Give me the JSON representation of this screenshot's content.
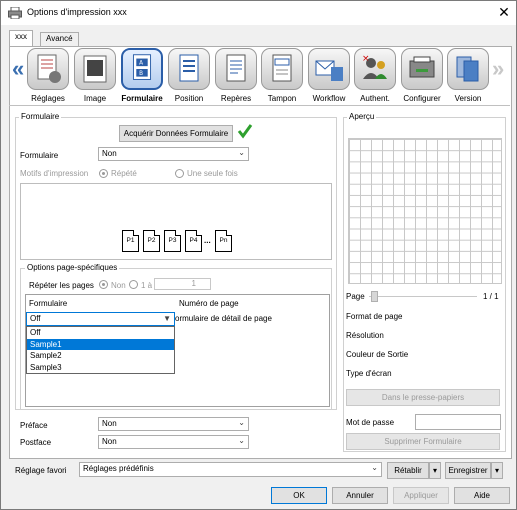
{
  "window": {
    "title": "Options d'impression xxx",
    "close": "✕"
  },
  "tabs": [
    "xxx",
    "Avancé"
  ],
  "nav": {
    "prev": "«",
    "next": "»"
  },
  "toolbar": [
    {
      "name": "reglages",
      "label": "Réglages"
    },
    {
      "name": "image",
      "label": "Image"
    },
    {
      "name": "formulaire",
      "label": "Formulaire"
    },
    {
      "name": "position",
      "label": "Position"
    },
    {
      "name": "reperes",
      "label": "Repères"
    },
    {
      "name": "tampon",
      "label": "Tampon"
    },
    {
      "name": "workflow",
      "label": "Workflow"
    },
    {
      "name": "authent",
      "label": "Authent."
    },
    {
      "name": "configurer",
      "label": "Configurer"
    },
    {
      "name": "version",
      "label": "Version"
    }
  ],
  "formulaire": {
    "group_label": "Formulaire",
    "acquire_button": "Acquérir Données Formulaire",
    "form_label": "Formulaire",
    "form_value": "Non",
    "motifs_label": "Motifs d'impression",
    "radio_repete": "Répété",
    "radio_seule": "Une seule fois",
    "pages": [
      "P1",
      "P2",
      "P3",
      "P4",
      "Pn"
    ],
    "ellipsis": "..."
  },
  "options": {
    "group_label": "Options page-spécifiques",
    "repeat_label": "Répéter les pages",
    "radio_non": "Non",
    "radio_1a": "1 à",
    "spin_value": "1",
    "col_formulaire": "Formulaire",
    "col_numero": "Numéro de page",
    "combo_value": "Off",
    "detail_text": "ormulaire de détail de page",
    "dropdown_items": [
      "Off",
      "Sample1",
      "Sample2",
      "Sample3"
    ],
    "dropdown_selected": "Sample1"
  },
  "preface": {
    "label": "Préface",
    "value": "Non"
  },
  "postface": {
    "label": "Postface",
    "value": "Non"
  },
  "apercu": {
    "group_label": "Aperçu",
    "page_label": "Page",
    "page_count": "1 / 1",
    "info": [
      "Format de page",
      "Résolution",
      "Couleur de Sortie",
      "Type d'écran"
    ],
    "clipboard_button": "Dans le presse-papiers",
    "password_label": "Mot de passe",
    "delete_button": "Supprimer Formulaire"
  },
  "favori": {
    "label": "Réglage favori",
    "value": "Réglages prédéfinis",
    "restore": "Rétablir",
    "save": "Enregistrer"
  },
  "buttons": {
    "ok": "OK",
    "cancel": "Annuler",
    "apply": "Appliquer",
    "help": "Aide"
  },
  "colors": {
    "accent": "#0078d7",
    "check": "#2ea02e",
    "nav_arrow": "#3a6fb0"
  }
}
